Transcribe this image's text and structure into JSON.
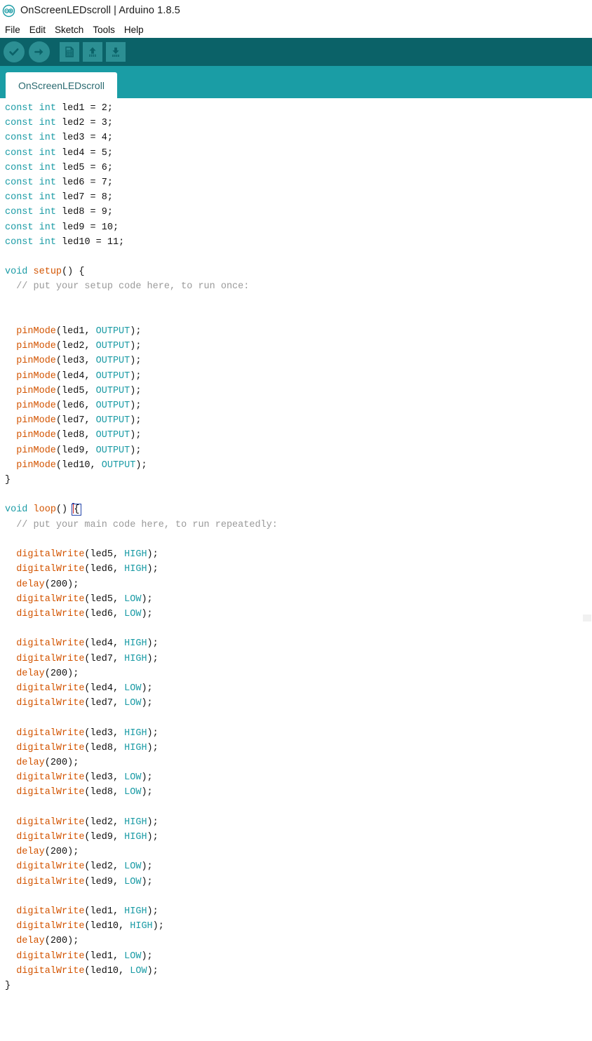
{
  "window": {
    "title": "OnScreenLEDscroll | Arduino 1.8.5",
    "logo_icon": "arduino-infinity-logo"
  },
  "menu": {
    "items": [
      {
        "label": "File"
      },
      {
        "label": "Edit"
      },
      {
        "label": "Sketch"
      },
      {
        "label": "Tools"
      },
      {
        "label": "Help"
      }
    ]
  },
  "toolbar": {
    "background": "#0b6268",
    "button_background": "#2c8f93",
    "buttons": [
      {
        "name": "verify",
        "icon": "checkmark-icon",
        "shape": "round"
      },
      {
        "name": "upload",
        "icon": "arrow-right-icon",
        "shape": "round"
      },
      {
        "name": "new",
        "icon": "new-document-icon",
        "shape": "square"
      },
      {
        "name": "open",
        "icon": "arrow-up-icon",
        "shape": "square"
      },
      {
        "name": "save",
        "icon": "arrow-down-icon",
        "shape": "square"
      }
    ]
  },
  "tabs": {
    "background": "#1a9da5",
    "active": "OnScreenLEDscroll",
    "items": [
      {
        "label": "OnScreenLEDscroll"
      }
    ]
  },
  "editor": {
    "colors": {
      "keyword": "#1a9ba5",
      "function": "#d35400",
      "constant": "#1a9ba5",
      "comment": "#9a9a9a",
      "text": "#111111",
      "background": "#ffffff",
      "brace_match_outline": "#2244aa",
      "caret": "#cc2222"
    },
    "code": "const int led1 = 2;\nconst int led2 = 3;\nconst int led3 = 4;\nconst int led4 = 5;\nconst int led5 = 6;\nconst int led6 = 7;\nconst int led7 = 8;\nconst int led8 = 9;\nconst int led9 = 10;\nconst int led10 = 11;\n\nvoid setup() {\n  // put your setup code here, to run once:\n\n\n  pinMode(led1, OUTPUT);\n  pinMode(led2, OUTPUT);\n  pinMode(led3, OUTPUT);\n  pinMode(led4, OUTPUT);\n  pinMode(led5, OUTPUT);\n  pinMode(led6, OUTPUT);\n  pinMode(led7, OUTPUT);\n  pinMode(led8, OUTPUT);\n  pinMode(led9, OUTPUT);\n  pinMode(led10, OUTPUT);\n}\n\nvoid loop() {\n  // put your main code here, to run repeatedly:\n\n  digitalWrite(led5, HIGH);\n  digitalWrite(led6, HIGH);\n  delay(200);\n  digitalWrite(led5, LOW);\n  digitalWrite(led6, LOW);\n\n  digitalWrite(led4, HIGH);\n  digitalWrite(led7, HIGH);\n  delay(200);\n  digitalWrite(led4, LOW);\n  digitalWrite(led7, LOW);\n\n  digitalWrite(led3, HIGH);\n  digitalWrite(led8, HIGH);\n  delay(200);\n  digitalWrite(led3, LOW);\n  digitalWrite(led8, LOW);\n\n  digitalWrite(led2, HIGH);\n  digitalWrite(led9, HIGH);\n  delay(200);\n  digitalWrite(led2, LOW);\n  digitalWrite(led9, LOW);\n\n  digitalWrite(led1, HIGH);\n  digitalWrite(led10, HIGH);\n  delay(200);\n  digitalWrite(led1, LOW);\n  digitalWrite(led10, LOW);\n}"
  }
}
